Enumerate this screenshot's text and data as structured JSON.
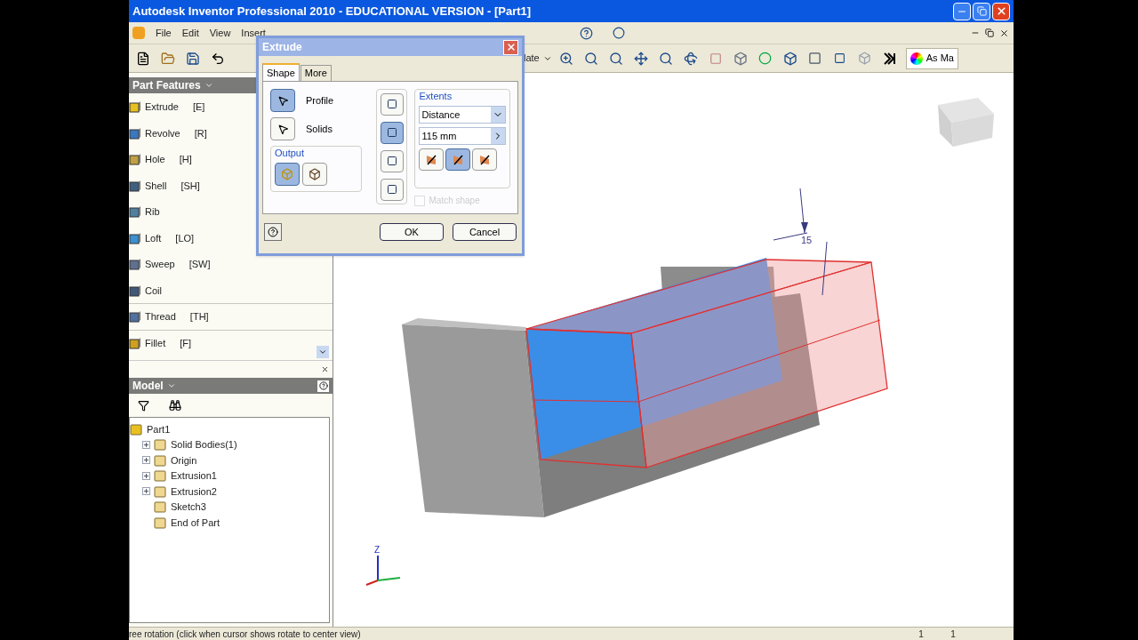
{
  "window": {
    "title": "Autodesk Inventor Professional 2010 - EDUCATIONAL VERSION - [Part1]"
  },
  "menu": [
    "File",
    "Edit",
    "View",
    "Insert"
  ],
  "toolbar": {
    "partial_label": "late",
    "style_label": "As Ma"
  },
  "part_features": {
    "title": "Part Features",
    "items": [
      {
        "label": "Extrude",
        "shortcut": "[E]",
        "separator_before": false
      },
      {
        "label": "Revolve",
        "shortcut": "[R]",
        "separator_before": false
      },
      {
        "label": "Hole",
        "shortcut": "[H]",
        "separator_before": false
      },
      {
        "label": "Shell",
        "shortcut": "[SH]",
        "separator_before": false
      },
      {
        "label": "Rib",
        "separator_before": false
      },
      {
        "label": "Loft",
        "shortcut": "[LO]",
        "separator_before": false
      },
      {
        "label": "Sweep",
        "shortcut": "[SW]",
        "separator_before": false
      },
      {
        "label": "Coil",
        "separator_before": false
      },
      {
        "label": "Thread",
        "shortcut": "[TH]",
        "separator_before": true
      },
      {
        "label": "Fillet",
        "shortcut": "[F]",
        "separator_before": true
      }
    ]
  },
  "model": {
    "title": "Model",
    "tree": [
      {
        "label": "Part1",
        "children": [
          {
            "label": "Solid Bodies(1)",
            "expanded": false
          },
          {
            "label": "Origin",
            "expanded": false
          },
          {
            "label": "Extrusion1",
            "expanded": false
          },
          {
            "label": "Extrusion2",
            "expanded": false
          },
          {
            "label": "Sketch3"
          },
          {
            "label": "End of Part"
          }
        ]
      }
    ]
  },
  "dialog": {
    "title": "Extrude",
    "tabs": [
      {
        "label": "Shape",
        "selected": true
      },
      {
        "label": "More",
        "selected": false
      }
    ],
    "selectors": [
      {
        "label": "Profile",
        "selected": true
      },
      {
        "label": "Solids",
        "selected": false
      }
    ],
    "output": {
      "label": "Output",
      "options": [
        {
          "selected": true
        },
        {
          "selected": false
        }
      ]
    },
    "operations": [
      {
        "selected": false
      },
      {
        "selected": true
      },
      {
        "selected": false
      },
      {
        "selected": false
      }
    ],
    "extents": {
      "label": "Extents",
      "type": "Distance",
      "distance": "115 mm",
      "directions": [
        {
          "selected": false
        },
        {
          "selected": true
        },
        {
          "selected": false
        }
      ]
    },
    "match_shape": {
      "label": "Match shape",
      "checked": false,
      "disabled": true
    },
    "buttons": [
      "OK",
      "Cancel"
    ]
  },
  "viewport": {
    "dimension": "15",
    "axis_label": "Z"
  },
  "status_bar": {
    "message": "ree rotation (click when cursor shows rotate to center view)",
    "fields": [
      "1",
      "1"
    ]
  }
}
